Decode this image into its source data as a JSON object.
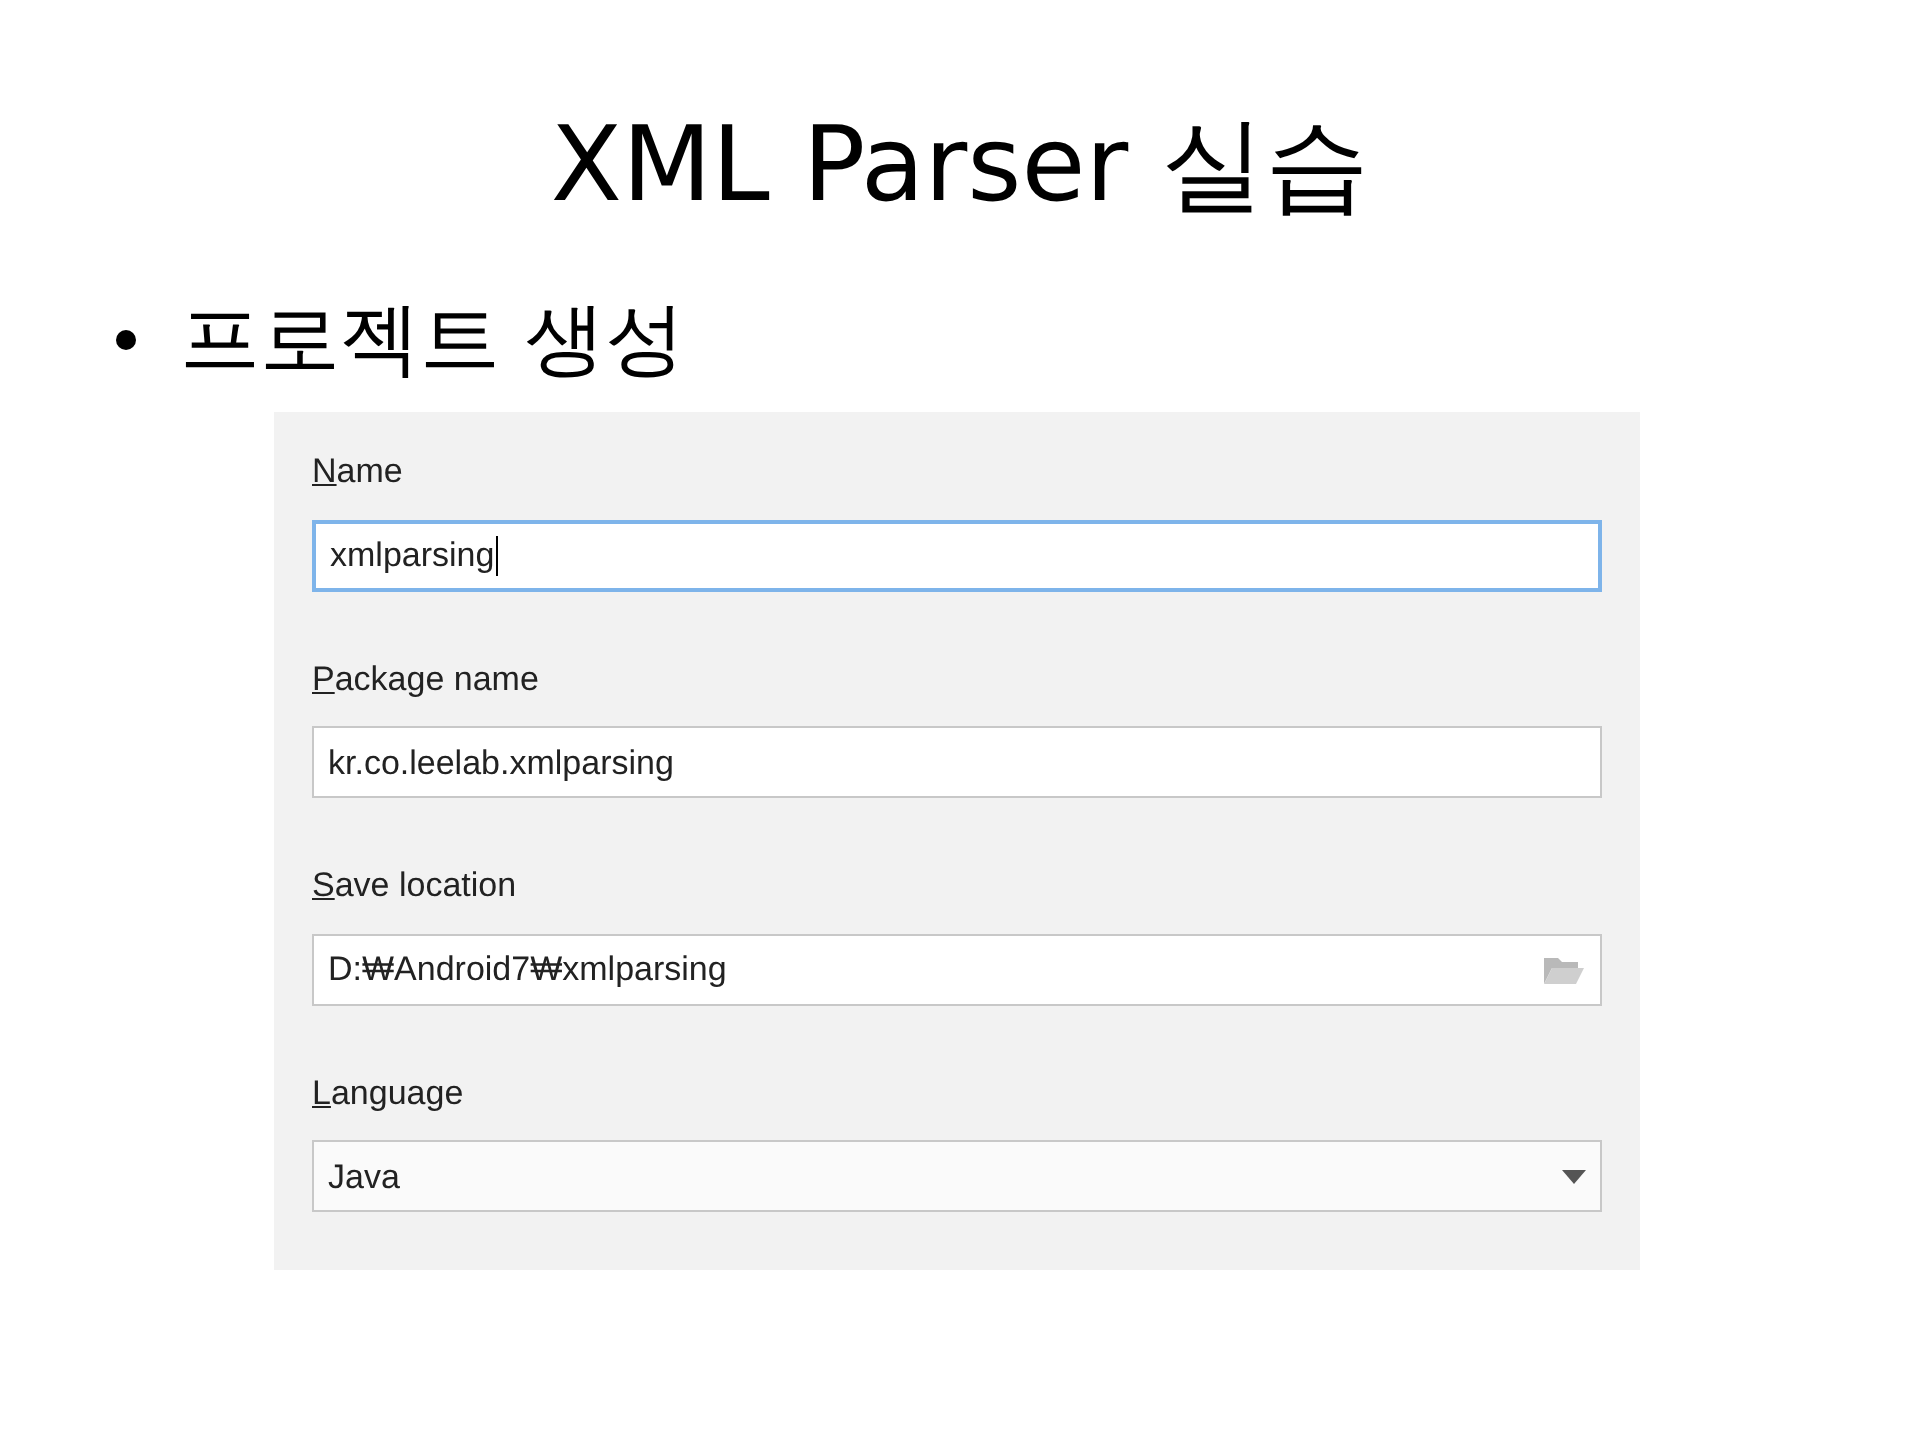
{
  "slide": {
    "title": "XML Parser 실습",
    "bullet": "프로젝트 생성"
  },
  "form": {
    "fields": [
      {
        "label": "Name",
        "kind": "text",
        "value": "xmlparsing",
        "focused": true
      },
      {
        "label": "Package name",
        "kind": "text",
        "value": "kr.co.leelab.xmlparsing",
        "focused": false
      },
      {
        "label": "Save location",
        "kind": "folder",
        "value": "D:₩Android7₩xmlparsing",
        "focused": false
      },
      {
        "label": "Language",
        "kind": "dropdown",
        "value": "Java",
        "focused": false
      }
    ]
  }
}
